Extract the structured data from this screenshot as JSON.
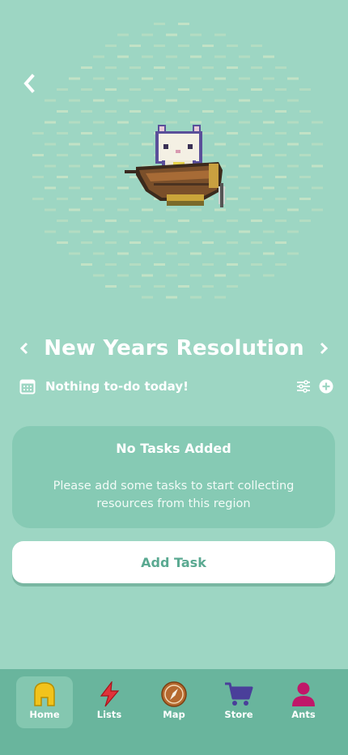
{
  "region": {
    "title": "New Years Resolution"
  },
  "today": {
    "message": "Nothing to-do today!"
  },
  "empty_state": {
    "title": "No Tasks Added",
    "message": "Please add some tasks to start collecting resources from this region"
  },
  "actions": {
    "add_task_label": "Add Task"
  },
  "tabs": [
    {
      "label": "Home",
      "icon": "home-icon",
      "color": "#f2c31b",
      "active": true
    },
    {
      "label": "Lists",
      "icon": "lightning-icon",
      "color": "#e0333a",
      "active": false
    },
    {
      "label": "Map",
      "icon": "compass-icon",
      "color": "#b5692f",
      "active": false
    },
    {
      "label": "Store",
      "icon": "cart-icon",
      "color": "#4a3f9a",
      "active": false
    },
    {
      "label": "Ants",
      "icon": "person-icon",
      "color": "#c01769",
      "active": false
    }
  ],
  "colors": {
    "background": "#9dd6c3",
    "card": "#86cab4",
    "tabbar": "#69b59d",
    "accent_text": "#5aa991"
  }
}
